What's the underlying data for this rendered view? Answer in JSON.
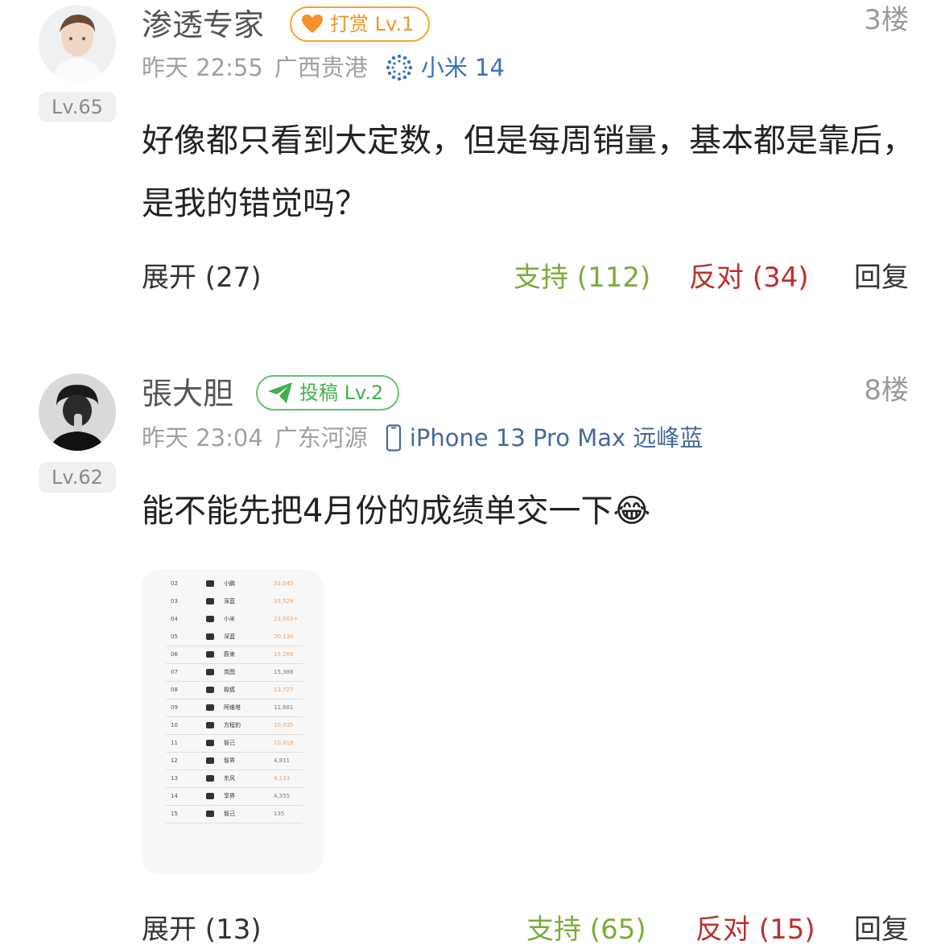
{
  "comments": [
    {
      "username": "渗透专家",
      "badge": "打赏 Lv.1",
      "floor": "3楼",
      "level": "Lv.65",
      "time": "昨天 22:55",
      "location": "广西贵港",
      "device": "小米 14",
      "text": "好像都只看到大定数，但是每周销量，基本都是靠后，是我的错觉吗？",
      "actions": {
        "expand": "展开 (27)",
        "support": "支持 (112)",
        "oppose": "反对 (34)",
        "reply": "回复"
      }
    },
    {
      "username": "張大胆",
      "badge": "投稿 Lv.2",
      "floor": "8楼",
      "level": "Lv.62",
      "time": "昨天 23:04",
      "location": "广东河源",
      "device": "iPhone 13 Pro Max 远峰蓝",
      "text": "能不能先把4月份的成绩单交一下😂",
      "actions": {
        "expand": "展开 (13)",
        "support": "支持 (65)",
        "oppose": "反对 (15)",
        "reply": "回复"
      }
    }
  ],
  "thumbnail": {
    "rows": [
      {
        "n": "02",
        "name": "小鹏",
        "value": "33,045"
      },
      {
        "n": "03",
        "name": "深蓝",
        "value": "33,529"
      },
      {
        "n": "04",
        "name": "小米",
        "value": "23,003+"
      },
      {
        "n": "05",
        "name": "深蓝",
        "value": "20,130"
      },
      {
        "n": "06",
        "name": "蔚来",
        "value": "15,269"
      },
      {
        "n": "07",
        "name": "岚图",
        "value": "15,388"
      },
      {
        "n": "08",
        "name": "极狐",
        "value": "13,727"
      },
      {
        "n": "09",
        "name": "阿维塔",
        "value": "11,681"
      },
      {
        "n": "10",
        "name": "方程豹",
        "value": "10,035"
      },
      {
        "n": "11",
        "name": "智己",
        "value": "10,019"
      },
      {
        "n": "12",
        "name": "智界",
        "value": "4,811"
      },
      {
        "n": "13",
        "name": "东风",
        "value": "4,133"
      },
      {
        "n": "14",
        "name": "享界",
        "value": "4,355"
      },
      {
        "n": "15",
        "name": "智己",
        "value": "135"
      }
    ]
  }
}
